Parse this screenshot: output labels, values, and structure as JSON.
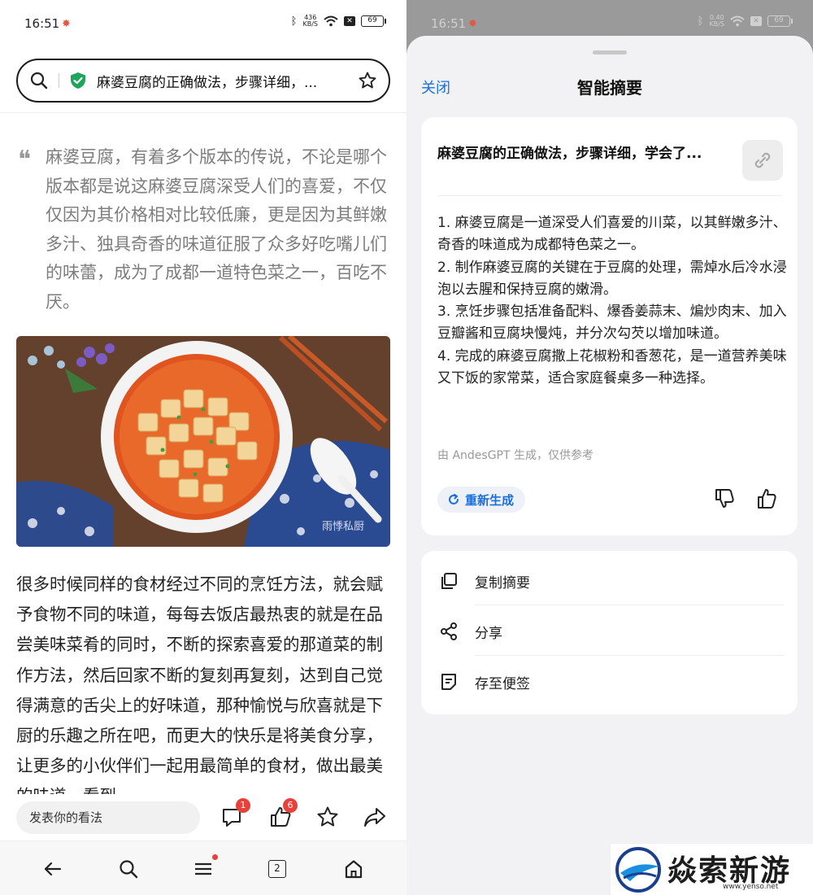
{
  "left": {
    "status": {
      "time": "16:51",
      "speed_top": "436",
      "speed_bottom": "KB/S",
      "battery": "69"
    },
    "urlbar": {
      "title": "麻婆豆腐的正确做法，步骤详细，..."
    },
    "quote": "麻婆豆腐，有着多个版本的传说，不论是哪个版本都是说这麻婆豆腐深受人们的喜爱，不仅仅因为其价格相对比较低廉，更是因为其鲜嫩多汁、独具奇香的味道征服了众多好吃嘴儿们的味蕾，成为了成都一道特色菜之一，百吃不厌。",
    "photo_credit": "雨悸私厨",
    "body": "很多时候同样的食材经过不同的烹饪方法，就会赋予食物不同的味道，每每去饭店最热衷的就是在品尝美味菜肴的同时，不断的探索喜爱的那道菜的制作方法，然后回家不断的复刻再复刻，达到自己觉得满意的舌尖上的好味道，那种愉悦与欣喜就是下厨的乐趣之所在吧，而更大的快乐是将美食分享，让更多的小伙伴们一起用最简单的食材，做出最美的味道，看到",
    "comment_placeholder": "发表你的看法",
    "comment_count": "1",
    "like_count": "6",
    "tab_count": "2"
  },
  "right": {
    "status": {
      "time": "16:51",
      "speed_top": "0.40",
      "speed_bottom": "KB/S",
      "battery": "69"
    },
    "close_label": "关闭",
    "sheet_title": "智能摘要",
    "article_title": "麻婆豆腐的正确做法，步骤详细，学会了...",
    "summary": [
      "1. 麻婆豆腐是一道深受人们喜爱的川菜，以其鲜嫩多汁、奇香的味道成为成都特色菜之一。",
      "2. 制作麻婆豆腐的关键在于豆腐的处理，需焯水后冷水浸泡以去腥和保持豆腐的嫩滑。",
      "3. 烹饪步骤包括准备配料、爆香姜蒜末、煸炒肉末、加入豆瓣酱和豆腐块慢炖，并分次勾芡以增加味道。",
      "4. 完成的麻婆豆腐撒上花椒粉和香葱花，是一道营养美味又下饭的家常菜，适合家庭餐桌多一种选择。"
    ],
    "gen_note": "由 AndesGPT 生成，仅供参考",
    "regen_label": "重新生成",
    "actions": [
      {
        "label": "复制摘要",
        "icon": "copy-icon"
      },
      {
        "label": "分享",
        "icon": "share-icon"
      },
      {
        "label": "存至便签",
        "icon": "note-icon"
      }
    ],
    "accent": "#1a6fe0"
  },
  "watermark": {
    "text": "焱索新游网",
    "url": "www.yenso.net"
  }
}
